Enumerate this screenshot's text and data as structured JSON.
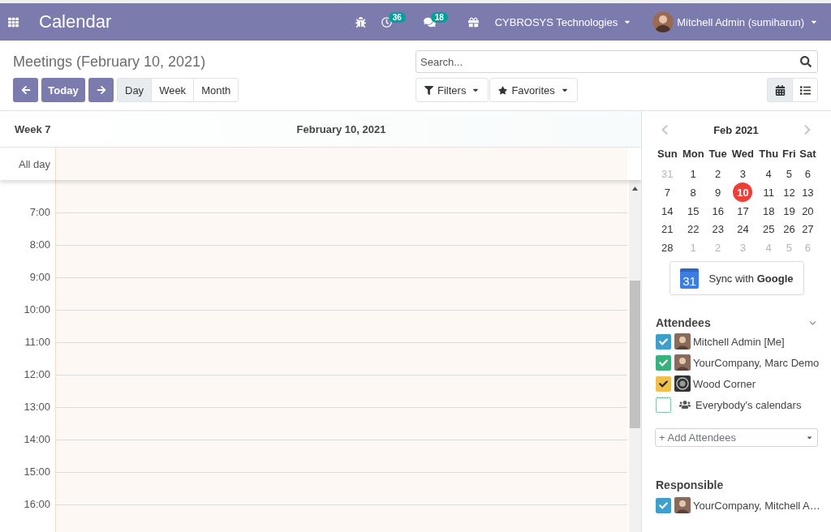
{
  "navbar": {
    "app_title": "Calendar",
    "activity_badge": "36",
    "messages_badge": "18",
    "company": "CYBROSYS Technologies",
    "user": "Mitchell Admin (sumiharun)"
  },
  "control_panel": {
    "title": "Meetings (February 10, 2021)",
    "today_button": "Today",
    "scales": [
      {
        "label": "Day",
        "selected": true
      },
      {
        "label": "Week",
        "selected": false
      },
      {
        "label": "Month",
        "selected": false
      }
    ],
    "search": {
      "placeholder": "Search..."
    },
    "filters_button": "Filters",
    "favorites_button": "Favorites",
    "views": [
      {
        "kind": "calendar",
        "selected": true
      },
      {
        "kind": "list",
        "selected": false
      }
    ]
  },
  "calendar": {
    "week_label": "Week 7",
    "day_heading": "February 10, 2021",
    "all_day_label": "All day",
    "hours": [
      "7:00",
      "8:00",
      "9:00",
      "10:00",
      "11:00",
      "12:00",
      "13:00",
      "14:00",
      "15:00",
      "16:00"
    ]
  },
  "sidebar": {
    "mini_calendar": {
      "month_title": "Feb 2021",
      "weekdays": [
        "Sun",
        "Mon",
        "Tue",
        "Wed",
        "Thu",
        "Fri",
        "Sat"
      ],
      "weeks": [
        [
          {
            "label": "31",
            "other_month": true,
            "selected": false
          },
          {
            "label": "1",
            "other_month": false,
            "selected": false
          },
          {
            "label": "2",
            "other_month": false,
            "selected": false
          },
          {
            "label": "3",
            "other_month": false,
            "selected": false
          },
          {
            "label": "4",
            "other_month": false,
            "selected": false
          },
          {
            "label": "5",
            "other_month": false,
            "selected": false
          },
          {
            "label": "6",
            "other_month": false,
            "selected": false
          }
        ],
        [
          {
            "label": "7",
            "other_month": false,
            "selected": false
          },
          {
            "label": "8",
            "other_month": false,
            "selected": false
          },
          {
            "label": "9",
            "other_month": false,
            "selected": false
          },
          {
            "label": "10",
            "other_month": false,
            "selected": true
          },
          {
            "label": "11",
            "other_month": false,
            "selected": false
          },
          {
            "label": "12",
            "other_month": false,
            "selected": false
          },
          {
            "label": "13",
            "other_month": false,
            "selected": false
          }
        ],
        [
          {
            "label": "14",
            "other_month": false,
            "selected": false
          },
          {
            "label": "15",
            "other_month": false,
            "selected": false
          },
          {
            "label": "16",
            "other_month": false,
            "selected": false
          },
          {
            "label": "17",
            "other_month": false,
            "selected": false
          },
          {
            "label": "18",
            "other_month": false,
            "selected": false
          },
          {
            "label": "19",
            "other_month": false,
            "selected": false
          },
          {
            "label": "20",
            "other_month": false,
            "selected": false
          }
        ],
        [
          {
            "label": "21",
            "other_month": false,
            "selected": false
          },
          {
            "label": "22",
            "other_month": false,
            "selected": false
          },
          {
            "label": "23",
            "other_month": false,
            "selected": false
          },
          {
            "label": "24",
            "other_month": false,
            "selected": false
          },
          {
            "label": "25",
            "other_month": false,
            "selected": false
          },
          {
            "label": "26",
            "other_month": false,
            "selected": false
          },
          {
            "label": "27",
            "other_month": false,
            "selected": false
          }
        ],
        [
          {
            "label": "28",
            "other_month": false,
            "selected": false
          },
          {
            "label": "1",
            "other_month": true,
            "selected": false
          },
          {
            "label": "2",
            "other_month": true,
            "selected": false
          },
          {
            "label": "3",
            "other_month": true,
            "selected": false
          },
          {
            "label": "4",
            "other_month": true,
            "selected": false
          },
          {
            "label": "5",
            "other_month": true,
            "selected": false
          },
          {
            "label": "6",
            "other_month": true,
            "selected": false
          }
        ]
      ]
    },
    "sync_button": {
      "icon_text": "31",
      "label": "Sync with **Google**"
    },
    "attendees": {
      "title": "Attendees",
      "items": [
        {
          "name": "Mitchell Admin [Me]",
          "kind": "person",
          "checked": true,
          "color": "#3f9fcc"
        },
        {
          "name": "YourCompany, Marc Demo",
          "kind": "person",
          "checked": true,
          "color": "#36b27a"
        },
        {
          "name": "Wood Corner",
          "kind": "company",
          "checked": true,
          "color": "#f0c04a"
        },
        {
          "name": "Everybody's calendars",
          "kind": "everybody",
          "checked": false
        }
      ],
      "add_field": {
        "placeholder": "+ Add Attendees"
      }
    },
    "responsible": {
      "title": "Responsible",
      "items": [
        {
          "name": "YourCompany, Mitchell A…",
          "kind": "person",
          "checked": true,
          "color": "#3f9fcc"
        }
      ]
    }
  }
}
